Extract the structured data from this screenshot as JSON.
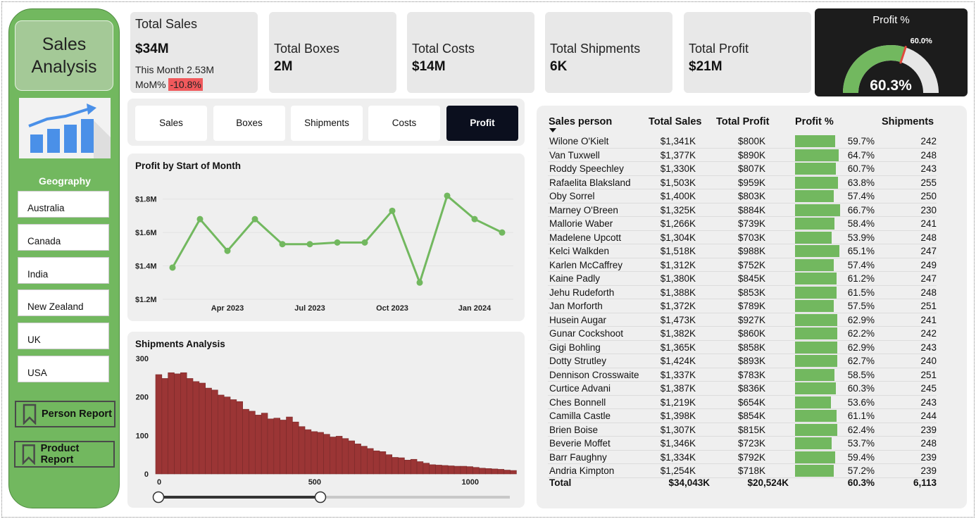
{
  "sidebar": {
    "title_line1": "Sales",
    "title_line2": "Analysis",
    "geography_label": "Geography",
    "geographies": [
      "Australia",
      "Canada",
      "India",
      "New Zealand",
      "UK",
      "USA"
    ],
    "person_report": "Person Report",
    "product_report": "Product Report",
    "chart_icon": "bar-chart-trend-icon",
    "bookmark_icon": "bookmark-icon"
  },
  "kpis": {
    "total_sales_label": "Total Sales",
    "total_sales_value": "$34M",
    "this_month_text": "This Month 2.53M",
    "mom_label": "MoM%",
    "mom_value": "-10.8%",
    "total_boxes_label": "Total Boxes",
    "total_boxes_value": "2M",
    "total_costs_label": "Total Costs",
    "total_costs_value": "$14M",
    "total_shipments_label": "Total Shipments",
    "total_shipments_value": "6K",
    "total_profit_label": "Total Profit",
    "total_profit_value": "$21M"
  },
  "gauge": {
    "title": "Profit %",
    "value_text": "60.3%",
    "target_text": "60.0%",
    "value": 0.603,
    "target": 0.6,
    "fill_color": "#72b85f",
    "track_color": "#e6e6e6",
    "target_color": "#e0483c"
  },
  "tabs": [
    {
      "label": "Sales",
      "active": false
    },
    {
      "label": "Boxes",
      "active": false
    },
    {
      "label": "Shipments",
      "active": false
    },
    {
      "label": "Costs",
      "active": false
    },
    {
      "label": "Profit",
      "active": true
    }
  ],
  "profit_chart": {
    "title": "Profit by Start of Month"
  },
  "shipments_chart": {
    "title": "Shipments Analysis",
    "slider_min": 0,
    "slider_max": 1150,
    "range_low": 0,
    "range_high": 530
  },
  "chart_data": [
    {
      "type": "line",
      "title": "Profit by Start of Month",
      "x": [
        "Feb 2023",
        "Mar 2023",
        "Apr 2023",
        "May 2023",
        "Jun 2023",
        "Jul 2023",
        "Aug 2023",
        "Sep 2023",
        "Oct 2023",
        "Nov 2023",
        "Dec 2023",
        "Jan 2024",
        "Feb 2024"
      ],
      "y": [
        1.39,
        1.68,
        1.49,
        1.68,
        1.53,
        1.53,
        1.54,
        1.54,
        1.73,
        1.3,
        1.82,
        1.68,
        1.6
      ],
      "y_unit": "$M",
      "yticks": [
        "$1.2M",
        "$1.4M",
        "$1.6M",
        "$1.8M"
      ],
      "ylim": [
        1.2,
        1.9
      ],
      "xticks": [
        {
          "label": "Apr 2023",
          "index": 2
        },
        {
          "label": "Jul 2023",
          "index": 5
        },
        {
          "label": "Oct 2023",
          "index": 8
        },
        {
          "label": "Jan 2024",
          "index": 11
        }
      ],
      "color": "#72b85f",
      "grid": true
    },
    {
      "type": "bar",
      "title": "Shipments Analysis",
      "xlim": [
        0,
        1150
      ],
      "xticks": [
        0,
        500,
        1000
      ],
      "ylim": [
        0,
        300
      ],
      "yticks": [
        0,
        100,
        200,
        300
      ],
      "bin_width": 20,
      "values": [
        258,
        248,
        263,
        260,
        263,
        248,
        240,
        236,
        223,
        218,
        205,
        200,
        193,
        188,
        168,
        163,
        153,
        158,
        143,
        145,
        140,
        148,
        135,
        123,
        115,
        110,
        108,
        103,
        96,
        98,
        92,
        86,
        78,
        72,
        66,
        60,
        58,
        50,
        43,
        42,
        36,
        38,
        32,
        28,
        24,
        23,
        22,
        21,
        20,
        20,
        19,
        17,
        15,
        14,
        13,
        12,
        10,
        9
      ],
      "color": "#9b3535"
    }
  ],
  "table": {
    "headers": [
      "Sales person",
      "Total Sales",
      "Total Profit",
      "Profit %",
      "Shipments"
    ],
    "rows": [
      {
        "name": "Wilone O'Kielt",
        "sales": "$1,341K",
        "profit": "$800K",
        "pct": "59.7%",
        "pct_value": 59.7,
        "ship": "242"
      },
      {
        "name": "Van Tuxwell",
        "sales": "$1,377K",
        "profit": "$890K",
        "pct": "64.7%",
        "pct_value": 64.7,
        "ship": "248"
      },
      {
        "name": "Roddy Speechley",
        "sales": "$1,330K",
        "profit": "$807K",
        "pct": "60.7%",
        "pct_value": 60.7,
        "ship": "243"
      },
      {
        "name": "Rafaelita Blaksland",
        "sales": "$1,503K",
        "profit": "$959K",
        "pct": "63.8%",
        "pct_value": 63.8,
        "ship": "255"
      },
      {
        "name": "Oby Sorrel",
        "sales": "$1,400K",
        "profit": "$803K",
        "pct": "57.4%",
        "pct_value": 57.4,
        "ship": "250"
      },
      {
        "name": "Marney O'Breen",
        "sales": "$1,325K",
        "profit": "$884K",
        "pct": "66.7%",
        "pct_value": 66.7,
        "ship": "230"
      },
      {
        "name": "Mallorie Waber",
        "sales": "$1,266K",
        "profit": "$739K",
        "pct": "58.4%",
        "pct_value": 58.4,
        "ship": "241"
      },
      {
        "name": "Madelene Upcott",
        "sales": "$1,304K",
        "profit": "$703K",
        "pct": "53.9%",
        "pct_value": 53.9,
        "ship": "248"
      },
      {
        "name": "Kelci Walkden",
        "sales": "$1,518K",
        "profit": "$988K",
        "pct": "65.1%",
        "pct_value": 65.1,
        "ship": "247"
      },
      {
        "name": "Karlen McCaffrey",
        "sales": "$1,312K",
        "profit": "$752K",
        "pct": "57.4%",
        "pct_value": 57.4,
        "ship": "249"
      },
      {
        "name": "Kaine Padly",
        "sales": "$1,380K",
        "profit": "$845K",
        "pct": "61.2%",
        "pct_value": 61.2,
        "ship": "247"
      },
      {
        "name": "Jehu Rudeforth",
        "sales": "$1,388K",
        "profit": "$853K",
        "pct": "61.5%",
        "pct_value": 61.5,
        "ship": "248"
      },
      {
        "name": "Jan Morforth",
        "sales": "$1,372K",
        "profit": "$789K",
        "pct": "57.5%",
        "pct_value": 57.5,
        "ship": "251"
      },
      {
        "name": "Husein Augar",
        "sales": "$1,473K",
        "profit": "$927K",
        "pct": "62.9%",
        "pct_value": 62.9,
        "ship": "241"
      },
      {
        "name": "Gunar Cockshoot",
        "sales": "$1,382K",
        "profit": "$860K",
        "pct": "62.2%",
        "pct_value": 62.2,
        "ship": "242"
      },
      {
        "name": "Gigi Bohling",
        "sales": "$1,365K",
        "profit": "$858K",
        "pct": "62.9%",
        "pct_value": 62.9,
        "ship": "243"
      },
      {
        "name": "Dotty Strutley",
        "sales": "$1,424K",
        "profit": "$893K",
        "pct": "62.7%",
        "pct_value": 62.7,
        "ship": "240"
      },
      {
        "name": "Dennison Crosswaite",
        "sales": "$1,337K",
        "profit": "$783K",
        "pct": "58.5%",
        "pct_value": 58.5,
        "ship": "251"
      },
      {
        "name": "Curtice Advani",
        "sales": "$1,387K",
        "profit": "$836K",
        "pct": "60.3%",
        "pct_value": 60.3,
        "ship": "245"
      },
      {
        "name": "Ches Bonnell",
        "sales": "$1,219K",
        "profit": "$654K",
        "pct": "53.6%",
        "pct_value": 53.6,
        "ship": "243"
      },
      {
        "name": "Camilla Castle",
        "sales": "$1,398K",
        "profit": "$854K",
        "pct": "61.1%",
        "pct_value": 61.1,
        "ship": "244"
      },
      {
        "name": "Brien Boise",
        "sales": "$1,307K",
        "profit": "$815K",
        "pct": "62.4%",
        "pct_value": 62.4,
        "ship": "239"
      },
      {
        "name": "Beverie Moffet",
        "sales": "$1,346K",
        "profit": "$723K",
        "pct": "53.7%",
        "pct_value": 53.7,
        "ship": "248"
      },
      {
        "name": "Barr Faughny",
        "sales": "$1,334K",
        "profit": "$792K",
        "pct": "59.4%",
        "pct_value": 59.4,
        "ship": "239"
      },
      {
        "name": "Andria Kimpton",
        "sales": "$1,254K",
        "profit": "$718K",
        "pct": "57.2%",
        "pct_value": 57.2,
        "ship": "239"
      }
    ],
    "total": {
      "label": "Total",
      "sales": "$34,043K",
      "profit": "$20,524K",
      "pct": "60.3%",
      "ship": "6,113"
    },
    "bar_color": "#72b85f",
    "sort_icon": "sort-descending-icon"
  }
}
